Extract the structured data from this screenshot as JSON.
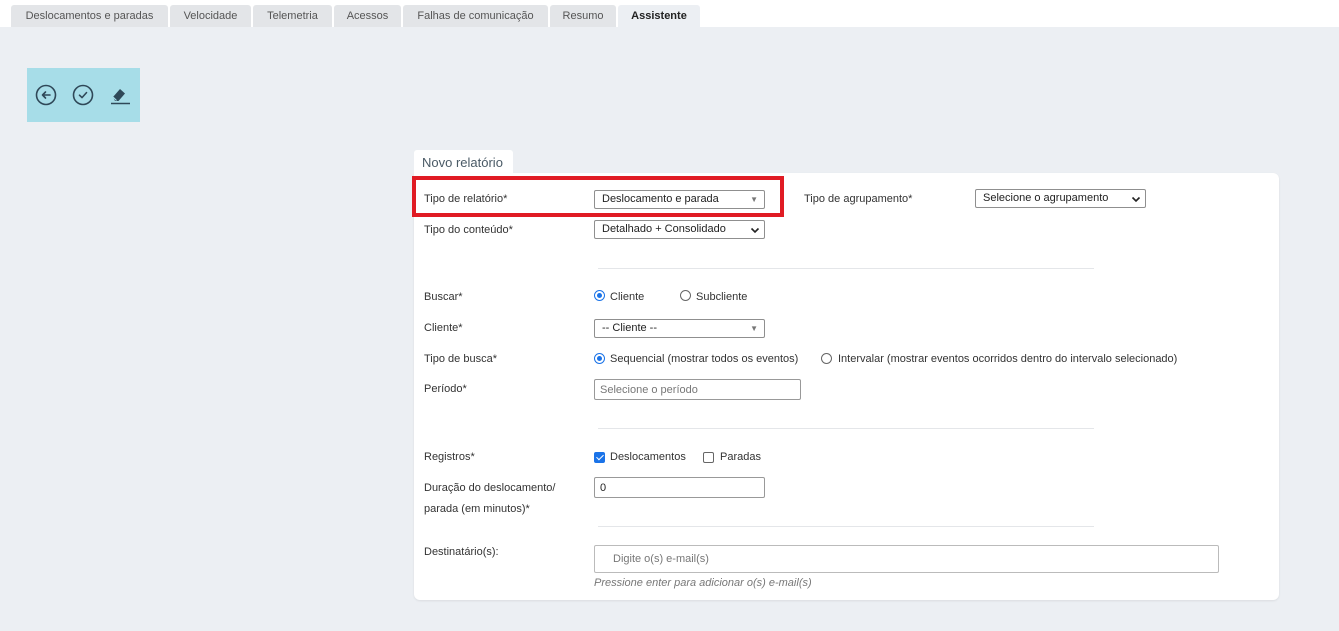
{
  "tabs": [
    {
      "label": "Deslocamentos e paradas",
      "active": false
    },
    {
      "label": "Velocidade",
      "active": false
    },
    {
      "label": "Telemetria",
      "active": false
    },
    {
      "label": "Acessos",
      "active": false
    },
    {
      "label": "Falhas de comunicação",
      "active": false
    },
    {
      "label": "Resumo",
      "active": false
    },
    {
      "label": "Assistente",
      "active": true
    }
  ],
  "toolbar": {
    "icons": [
      "back-icon",
      "confirm-icon",
      "eraser-icon"
    ],
    "background": "#a7dde8"
  },
  "card": {
    "title": "Novo relatório"
  },
  "form": {
    "report_type_label": "Tipo de relatório*",
    "report_type_value": "Deslocamento e parada",
    "grouping_label": "Tipo de agrupamento*",
    "grouping_value": "Selecione o agrupamento",
    "content_type_label": "Tipo do conteúdo*",
    "content_type_value": "Detalhado + Consolidado",
    "search_label": "Buscar*",
    "search_option_client": "Cliente",
    "search_option_subclient": "Subcliente",
    "client_label": "Cliente*",
    "client_value": "-- Cliente --",
    "search_type_label": "Tipo de busca*",
    "search_type_sequential": "Sequencial (mostrar todos os eventos)",
    "search_type_interval": "Intervalar (mostrar eventos ocorridos dentro do intervalo selecionado)",
    "period_label": "Período*",
    "period_placeholder": "Selecione o período",
    "records_label": "Registros*",
    "records_displacements": "Deslocamentos",
    "records_stops": "Paradas",
    "duration_label_line1": "Duração do deslocamento/",
    "duration_label_line2": "parada (em minutos)*",
    "duration_value": "0",
    "recipients_label": "Destinatário(s):",
    "recipients_placeholder": "Digite o(s) e-mail(s)",
    "recipients_hint": "Pressione enter para adicionar o(s) e-mail(s)"
  },
  "colors": {
    "accent": "#1a73e8",
    "highlight": "#e01b24",
    "page_bg": "#eceff3"
  }
}
